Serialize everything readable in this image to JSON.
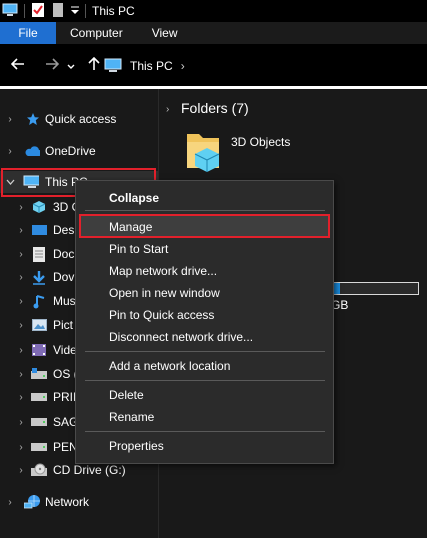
{
  "window": {
    "title": "This PC"
  },
  "ribbon": {
    "tabs": [
      "File",
      "Computer",
      "View"
    ]
  },
  "address": {
    "location": "This PC",
    "separator": "›"
  },
  "nav": {
    "quick_access": "Quick access",
    "onedrive": "OneDrive",
    "this_pc": "This PC",
    "children": [
      {
        "label": "3D O",
        "icon": "3d-objects-icon"
      },
      {
        "label": "Des",
        "icon": "desktop-icon"
      },
      {
        "label": "Doc",
        "icon": "documents-icon"
      },
      {
        "label": "Dov",
        "icon": "downloads-icon"
      },
      {
        "label": "Mus",
        "icon": "music-icon"
      },
      {
        "label": "Pict",
        "icon": "pictures-icon"
      },
      {
        "label": "Vide",
        "icon": "videos-icon"
      },
      {
        "label": "OS (",
        "icon": "os-drive-icon"
      },
      {
        "label": "PRIE",
        "icon": "drive-icon"
      },
      {
        "label": "SAG",
        "icon": "drive-icon"
      },
      {
        "label": "PEN",
        "icon": "drive-icon"
      },
      {
        "label": "CD Drive (G:)",
        "icon": "cd-drive-icon"
      }
    ],
    "network": "Network"
  },
  "content": {
    "folders_heading": "Folders (7)",
    "first_folder": "3D Objects",
    "drive_unit": "GB",
    "drive_used_fraction": 0.12
  },
  "context_menu": {
    "items": {
      "collapse": "Collapse",
      "manage": "Manage",
      "pin_start": "Pin to Start",
      "map_drive": "Map network drive...",
      "open_new": "Open in new window",
      "pin_quick": "Pin to Quick access",
      "disconnect": "Disconnect network drive...",
      "add_location": "Add a network location",
      "delete": "Delete",
      "rename": "Rename",
      "properties": "Properties"
    }
  },
  "colors": {
    "accent": "#1f6fd1",
    "highlight_border": "#e2202b",
    "nav_bg": "#191919",
    "menu_bg": "#2b2b2b"
  }
}
